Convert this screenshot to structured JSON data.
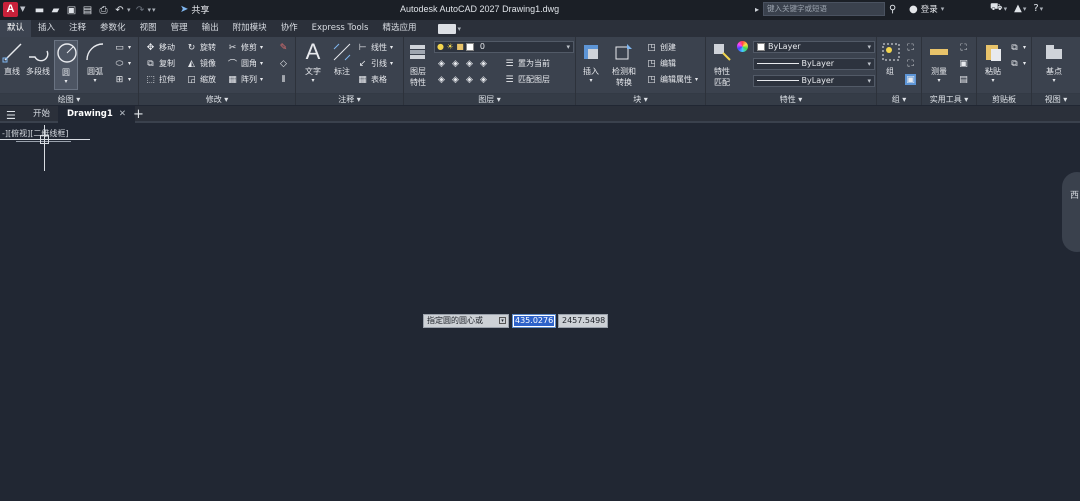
{
  "titlebar": {
    "logo": "A",
    "share_label": "共享",
    "window_title": "Autodesk AutoCAD 2027    Drawing1.dwg",
    "search_placeholder": "键入关键字或短语",
    "user_label": "登录"
  },
  "ribbon_tabs": [
    "默认",
    "插入",
    "注释",
    "参数化",
    "视图",
    "管理",
    "输出",
    "附加模块",
    "协作",
    "Express Tools",
    "精选应用"
  ],
  "panels": {
    "draw": {
      "title": "绘图 ▾",
      "line": "直线",
      "polyline": "多段线",
      "circle": "圆",
      "arc": "圆弧"
    },
    "modify": {
      "title": "修改 ▾",
      "move": "移动",
      "rotate": "旋转",
      "trim": "修剪",
      "copy": "复制",
      "mirror": "镜像",
      "fillet": "圆角",
      "stretch": "拉伸",
      "scale": "缩放",
      "array": "阵列"
    },
    "annotation": {
      "title": "注释 ▾",
      "text": "文字",
      "dimension": "标注",
      "linear": "线性",
      "leader": "引线",
      "table": "表格"
    },
    "layers": {
      "title": "图层 ▾",
      "layer_props_1": "图层",
      "layer_props_2": "特性",
      "current_layer": "0",
      "make_current": "置为当前",
      "match_layer": "匹配图层"
    },
    "block": {
      "title": "块 ▾",
      "insert": "插入",
      "detect_1": "检测和",
      "detect_2": "转换",
      "create": "创建",
      "edit": "编辑",
      "edit_attr": "编辑属性"
    },
    "properties": {
      "title": "特性 ▾",
      "match_1": "特性",
      "match_2": "匹配",
      "color": "ByLayer",
      "linetype": "ByLayer",
      "lineweight": "ByLayer"
    },
    "groups": {
      "title": "组 ▾",
      "group": "组"
    },
    "utilities": {
      "title": "实用工具 ▾",
      "measure": "测量"
    },
    "clipboard": {
      "title": "剪贴板",
      "paste": "粘贴"
    },
    "view": {
      "title": "视图 ▾",
      "base": "基点"
    }
  },
  "doc_tabs": {
    "start": "开始",
    "drawing": "Drawing1",
    "close": "✕"
  },
  "viewport": {
    "label": "-][俯视][二维线框]",
    "viewcube_letter": "西"
  },
  "dynamic_input": {
    "prompt": "指定圆的圆心或",
    "x_value": "435.0276",
    "y_value": "2457.5498"
  },
  "colors": {
    "background": "#212733",
    "ribbon": "#3b424e",
    "accent": "#c8213a",
    "highlight": "#2e62c9"
  }
}
